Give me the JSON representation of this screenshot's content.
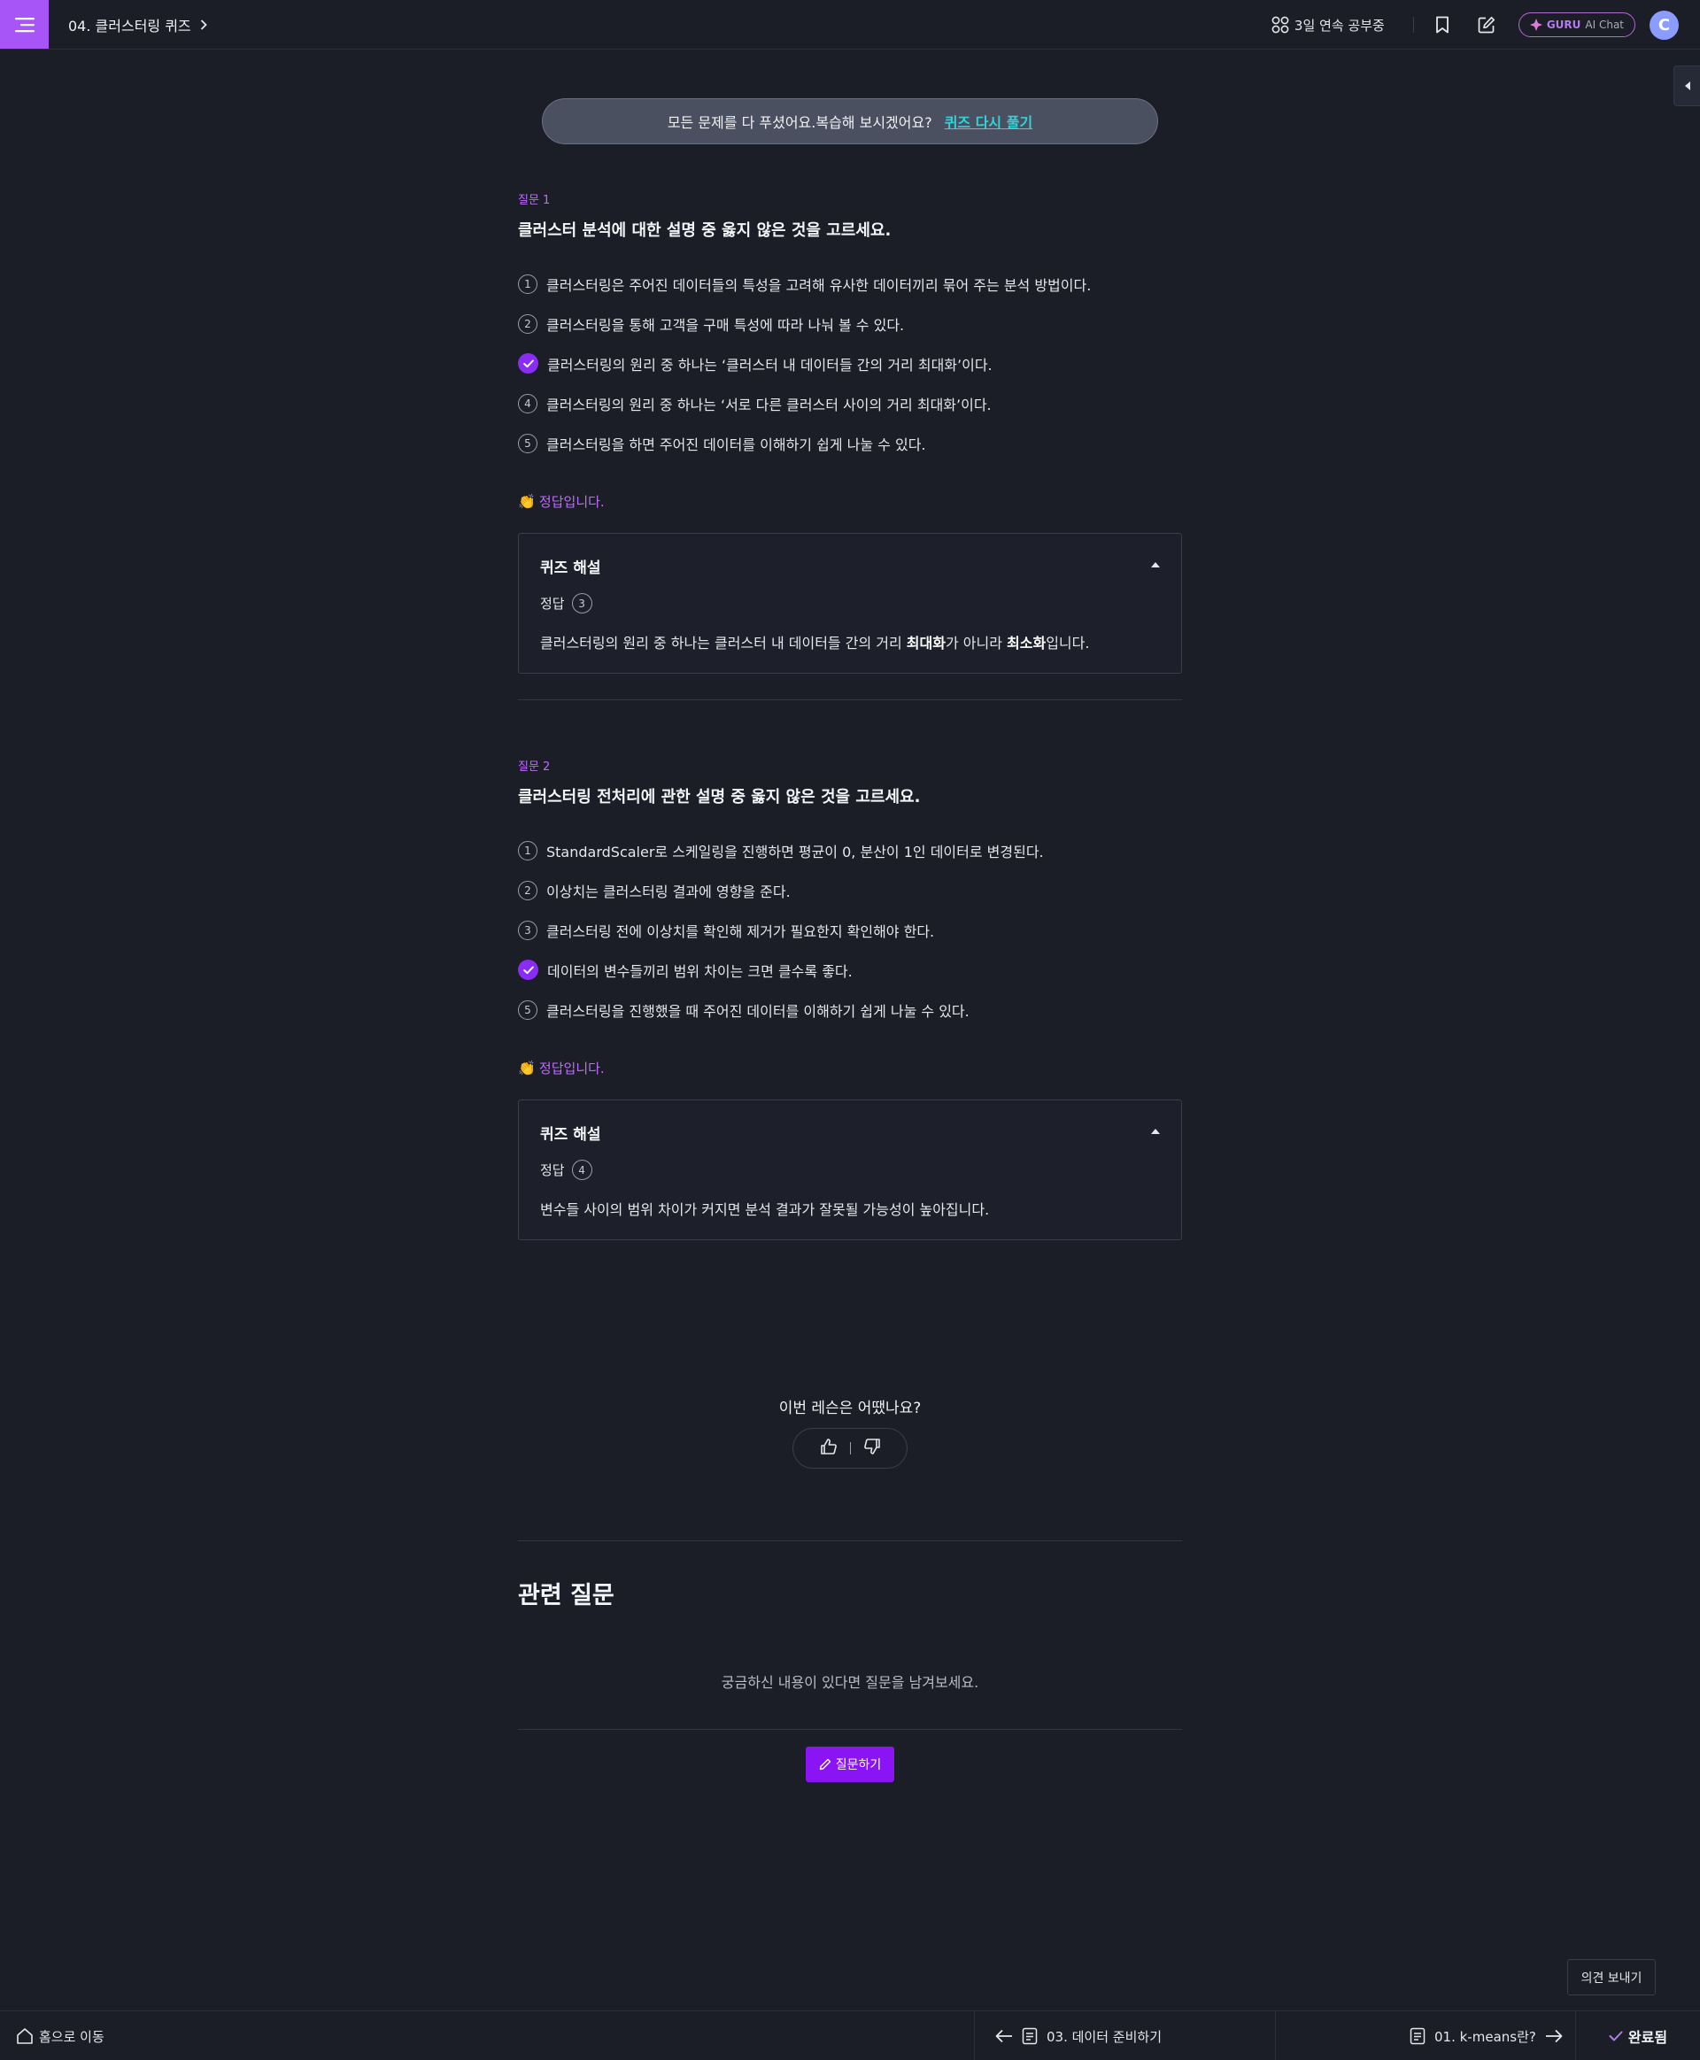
{
  "header": {
    "breadcrumb": "04. 클러스터링 퀴즈",
    "streak": "3일 연속 공부중",
    "guru_brand": "GURU",
    "guru_label": "AI Chat",
    "avatar_initial": "C"
  },
  "banner": {
    "message": "모든 문제를 다 푸셨어요.복습해 보시겠어요?",
    "retry": "퀴즈 다시 풀기"
  },
  "questions": [
    {
      "label": "질문 1",
      "title": "클러스터 분석에 대한 설명 중 옳지 않은 것을 고르세요.",
      "options": [
        {
          "num": "1",
          "text": "클러스터링은 주어진 데이터들의 특성을 고려해 유사한 데이터끼리 묶어 주는 분석 방법이다."
        },
        {
          "num": "2",
          "text": "클러스터링을 통해 고객을 구매 특성에 따라 나눠 볼 수 있다."
        },
        {
          "num": "3",
          "text": "클러스터링의 원리 중 하나는 ‘클러스터 내 데이터들 간의 거리 최대화’이다."
        },
        {
          "num": "4",
          "text": "클러스터링의 원리 중 하나는 ‘서로 다른 클러스터 사이의 거리 최대화’이다."
        },
        {
          "num": "5",
          "text": "클러스터링을 하면 주어진 데이터를 이해하기 쉽게 나눌 수 있다."
        }
      ],
      "selected": 3,
      "result": "정답입니다.",
      "explain_title": "퀴즈 해설",
      "answer_label": "정답",
      "answer_num": "3",
      "explain_parts": [
        "클러스터링의 원리 중 하나는 클러스터 내 데이터들 간의 거리 ",
        "최대화",
        "가 아니라 ",
        "최소화",
        "입니다."
      ]
    },
    {
      "label": "질문 2",
      "title": "클러스터링 전처리에 관한 설명 중 옳지 않은 것을 고르세요.",
      "options": [
        {
          "num": "1",
          "text": "StandardScaler로 스케일링을 진행하면 평균이 0, 분산이 1인 데이터로 변경된다."
        },
        {
          "num": "2",
          "text": "이상치는 클러스터링 결과에 영향을 준다."
        },
        {
          "num": "3",
          "text": "클러스터링 전에 이상치를 확인해 제거가 필요한지 확인해야 한다."
        },
        {
          "num": "4",
          "text": "데이터의 변수들끼리 범위 차이는 크면 클수록 좋다."
        },
        {
          "num": "5",
          "text": "클러스터링을 진행했을 때 주어진 데이터를 이해하기 쉽게 나눌 수 있다."
        }
      ],
      "selected": 4,
      "result": "정답입니다.",
      "explain_title": "퀴즈 해설",
      "answer_label": "정답",
      "answer_num": "4",
      "explain_parts": [
        "변수들 사이의 범위 차이가 커지면 분석 결과가 잘못될 가능성이 높아집니다."
      ]
    }
  ],
  "feedback": {
    "question": "이번 레슨은 어땠나요?"
  },
  "related": {
    "title": "관련 질문",
    "empty": "궁금하신 내용이 있다면 질문을 남겨보세요.",
    "ask": "질문하기"
  },
  "feedback_button": "의견 보내기",
  "bottom": {
    "home": "홈으로 이동",
    "prev": "03. 데이터 준비하기",
    "next": "01. k-means란?",
    "done": "완료됨"
  },
  "colors": {
    "accent": "#a855f7",
    "check": "#8b2cf5",
    "retry": "#34d1d6",
    "label": "#c06bff"
  }
}
